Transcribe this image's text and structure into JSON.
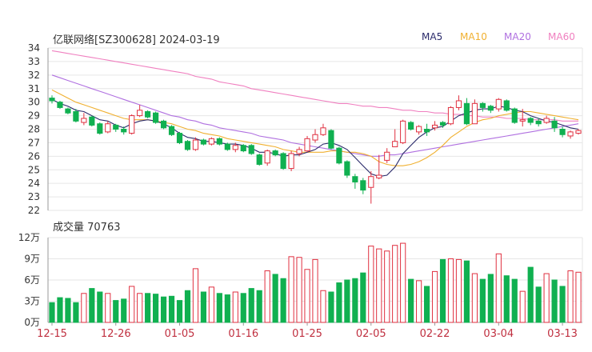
{
  "title": "亿联网络[SZ300628] 2024-03-19",
  "legend": [
    {
      "label": "MA5",
      "color": "#2b2b6b"
    },
    {
      "label": "MA10",
      "color": "#f0b030"
    },
    {
      "label": "MA20",
      "color": "#b070e0"
    },
    {
      "label": "MA60",
      "color": "#f080c0"
    }
  ],
  "colors": {
    "up": "#e03040",
    "down": "#10b050",
    "grid": "#e6e6e6",
    "axis_text": "#333333",
    "date_text": "#c03040"
  },
  "volume_label": "成交量 70763",
  "chart_data": {
    "type": "candlestick",
    "price_ylim": [
      22,
      34
    ],
    "price_ticks": [
      34,
      33,
      32,
      31,
      30,
      29,
      28,
      27,
      26,
      25,
      24,
      23,
      22
    ],
    "volume_ylim": [
      0,
      12
    ],
    "volume_ticks": [
      "12万",
      "9万",
      "6万",
      "3万",
      "0万"
    ],
    "volume_tick_values": [
      12,
      9,
      6,
      3,
      0
    ],
    "x_labels": [
      "12-15",
      "12-26",
      "01-05",
      "01-16",
      "01-25",
      "02-05",
      "02-22",
      "03-04",
      "03-13"
    ],
    "x_label_index": [
      0,
      8,
      16,
      24,
      32,
      40,
      48,
      56,
      64
    ],
    "candles": [
      [
        30.3,
        30.1,
        30.5,
        29.9,
        2.8
      ],
      [
        30.0,
        29.6,
        30.1,
        29.5,
        3.5
      ],
      [
        29.5,
        29.2,
        29.6,
        29.1,
        3.4
      ],
      [
        29.3,
        28.6,
        29.5,
        28.5,
        2.8
      ],
      [
        28.5,
        28.8,
        29.2,
        28.3,
        4.1
      ],
      [
        28.9,
        28.3,
        29.0,
        28.2,
        4.8
      ],
      [
        28.4,
        27.7,
        28.5,
        27.6,
        4.3
      ],
      [
        27.8,
        28.4,
        28.6,
        27.7,
        4.1
      ],
      [
        28.3,
        28.0,
        28.4,
        27.8,
        3.1
      ],
      [
        28.0,
        27.8,
        28.2,
        27.6,
        3.3
      ],
      [
        27.7,
        29.0,
        29.1,
        27.6,
        5.1
      ],
      [
        29.0,
        29.4,
        29.8,
        28.9,
        4.1
      ],
      [
        29.3,
        28.9,
        29.4,
        28.8,
        4.1
      ],
      [
        29.2,
        28.5,
        29.3,
        28.4,
        4.0
      ],
      [
        28.6,
        28.1,
        28.7,
        28.0,
        3.6
      ],
      [
        28.2,
        27.6,
        28.3,
        27.5,
        3.7
      ],
      [
        27.7,
        27.0,
        27.8,
        26.9,
        3.1
      ],
      [
        27.1,
        26.5,
        27.2,
        26.4,
        4.5
      ],
      [
        26.5,
        27.2,
        27.4,
        26.4,
        7.6
      ],
      [
        27.2,
        26.9,
        27.3,
        26.8,
        4.3
      ],
      [
        26.9,
        27.3,
        27.4,
        26.8,
        5.0
      ],
      [
        27.3,
        26.9,
        27.4,
        26.8,
        4.1
      ],
      [
        26.9,
        26.5,
        27.0,
        26.4,
        3.9
      ],
      [
        26.5,
        26.8,
        27.0,
        26.3,
        4.3
      ],
      [
        26.8,
        26.4,
        26.9,
        26.3,
        4.1
      ],
      [
        26.8,
        26.2,
        26.9,
        26.1,
        4.8
      ],
      [
        26.1,
        25.4,
        26.2,
        25.3,
        4.5
      ],
      [
        25.5,
        26.4,
        26.5,
        25.3,
        7.3
      ],
      [
        26.4,
        26.1,
        26.5,
        26.0,
        6.8
      ],
      [
        26.2,
        25.1,
        26.3,
        25.0,
        6.2
      ],
      [
        25.1,
        26.2,
        26.4,
        24.9,
        9.3
      ],
      [
        26.2,
        26.5,
        26.7,
        26.0,
        9.2
      ],
      [
        26.4,
        27.3,
        27.5,
        26.3,
        7.5
      ],
      [
        27.2,
        27.6,
        28.0,
        27.0,
        8.9
      ],
      [
        27.6,
        28.1,
        28.4,
        27.5,
        4.5
      ],
      [
        27.9,
        26.6,
        28.0,
        26.5,
        4.3
      ],
      [
        26.6,
        25.5,
        26.7,
        25.4,
        5.6
      ],
      [
        25.6,
        24.6,
        25.7,
        24.4,
        6.0
      ],
      [
        24.5,
        24.1,
        24.7,
        23.6,
        6.2
      ],
      [
        24.2,
        23.5,
        24.4,
        23.2,
        7.0
      ],
      [
        23.7,
        24.5,
        24.9,
        22.5,
        10.8
      ],
      [
        24.4,
        24.6,
        26.1,
        24.3,
        10.4
      ],
      [
        25.7,
        26.3,
        26.6,
        25.5,
        10.1
      ],
      [
        26.7,
        27.1,
        28.0,
        26.7,
        10.9
      ],
      [
        27.0,
        28.6,
        28.7,
        26.9,
        11.2
      ],
      [
        28.5,
        28.0,
        28.6,
        27.9,
        6.1
      ],
      [
        27.8,
        28.2,
        28.3,
        27.6,
        5.9
      ],
      [
        28.0,
        27.8,
        28.4,
        27.5,
        5.1
      ],
      [
        28.1,
        28.3,
        28.6,
        27.9,
        7.2
      ],
      [
        28.5,
        28.3,
        28.6,
        28.1,
        8.9
      ],
      [
        28.4,
        29.6,
        29.7,
        28.3,
        9.0
      ],
      [
        29.6,
        30.1,
        30.5,
        29.4,
        8.9
      ],
      [
        29.9,
        28.4,
        30.3,
        28.3,
        8.7
      ],
      [
        28.4,
        29.9,
        30.2,
        28.4,
        6.9
      ],
      [
        29.9,
        29.6,
        30.0,
        29.3,
        6.1
      ],
      [
        29.7,
        29.4,
        29.8,
        29.2,
        6.8
      ],
      [
        29.5,
        30.2,
        30.3,
        29.3,
        9.7
      ],
      [
        30.1,
        29.4,
        30.2,
        29.3,
        6.6
      ],
      [
        29.5,
        28.5,
        29.6,
        28.4,
        6.1
      ],
      [
        28.6,
        28.7,
        29.5,
        28.2,
        4.4
      ],
      [
        28.8,
        28.5,
        28.9,
        28.3,
        7.8
      ],
      [
        28.6,
        28.4,
        28.8,
        28.2,
        5.0
      ],
      [
        28.5,
        28.8,
        29.0,
        28.4,
        6.9
      ],
      [
        28.6,
        28.1,
        28.9,
        27.8,
        6.0
      ],
      [
        28.0,
        27.6,
        28.2,
        27.4,
        5.1
      ],
      [
        27.5,
        27.8,
        27.9,
        27.3,
        7.3
      ],
      [
        27.7,
        27.9,
        28.0,
        27.6,
        7.1
      ]
    ],
    "ma5": [
      30.2,
      29.9,
      29.7,
      29.4,
      29.3,
      29.0,
      28.7,
      28.6,
      28.3,
      28.1,
      28.4,
      28.6,
      28.7,
      28.6,
      28.4,
      28.1,
      27.7,
      27.4,
      27.3,
      27.1,
      27.1,
      27.0,
      26.9,
      26.9,
      26.8,
      26.6,
      26.3,
      26.3,
      26.2,
      26.0,
      26.1,
      26.1,
      26.3,
      26.5,
      26.9,
      27.0,
      26.8,
      26.5,
      25.9,
      25.3,
      24.7,
      24.5,
      24.6,
      25.2,
      26.2,
      26.8,
      27.4,
      27.8,
      28.1,
      28.2,
      28.6,
      29.0,
      29.2,
      29.4,
      29.5,
      29.5,
      29.7,
      29.6,
      29.4,
      29.3,
      29.0,
      28.8,
      28.6,
      28.5,
      28.3,
      28.1,
      28.0
    ],
    "ma10": [
      30.9,
      30.6,
      30.3,
      30.0,
      29.8,
      29.6,
      29.4,
      29.2,
      29.0,
      28.8,
      28.7,
      28.7,
      28.7,
      28.6,
      28.5,
      28.4,
      28.2,
      28.0,
      27.9,
      27.7,
      27.6,
      27.5,
      27.3,
      27.2,
      27.1,
      27.0,
      26.9,
      26.8,
      26.7,
      26.5,
      26.4,
      26.3,
      26.3,
      26.3,
      26.3,
      26.4,
      26.4,
      26.3,
      26.3,
      26.2,
      26.0,
      25.6,
      25.4,
      25.3,
      25.3,
      25.4,
      25.6,
      25.9,
      26.3,
      26.8,
      27.4,
      27.8,
      28.2,
      28.5,
      28.7,
      28.8,
      29.0,
      29.1,
      29.2,
      29.3,
      29.3,
      29.2,
      29.1,
      29.0,
      28.9,
      28.8,
      28.7
    ],
    "ma20": [
      32.0,
      31.8,
      31.6,
      31.4,
      31.2,
      31.0,
      30.8,
      30.6,
      30.4,
      30.2,
      30.0,
      29.8,
      29.6,
      29.4,
      29.2,
      29.0,
      28.9,
      28.7,
      28.6,
      28.4,
      28.3,
      28.1,
      28.0,
      27.9,
      27.8,
      27.7,
      27.5,
      27.4,
      27.3,
      27.2,
      27.0,
      26.9,
      26.8,
      26.7,
      26.6,
      26.5,
      26.4,
      26.3,
      26.2,
      26.1,
      26.0,
      26.0,
      26.1,
      26.1,
      26.2,
      26.3,
      26.4,
      26.5,
      26.6,
      26.7,
      26.8,
      26.9,
      27.0,
      27.1,
      27.2,
      27.3,
      27.4,
      27.5,
      27.6,
      27.7,
      27.8,
      27.9,
      28.0,
      28.1,
      28.2,
      28.3,
      28.4
    ],
    "ma60": [
      33.8,
      33.7,
      33.6,
      33.5,
      33.4,
      33.3,
      33.2,
      33.1,
      33.0,
      32.9,
      32.8,
      32.7,
      32.6,
      32.5,
      32.4,
      32.3,
      32.2,
      32.1,
      31.9,
      31.8,
      31.7,
      31.5,
      31.4,
      31.3,
      31.2,
      31.0,
      30.9,
      30.8,
      30.7,
      30.6,
      30.5,
      30.4,
      30.3,
      30.2,
      30.1,
      30.0,
      29.9,
      29.9,
      29.8,
      29.7,
      29.7,
      29.6,
      29.6,
      29.5,
      29.4,
      29.4,
      29.3,
      29.3,
      29.2,
      29.2,
      29.1,
      29.1,
      29.0,
      29.0,
      28.9,
      28.9,
      28.9,
      28.8,
      28.8,
      28.8,
      28.7,
      28.7,
      28.7,
      28.7,
      28.6,
      28.6,
      28.6
    ]
  }
}
